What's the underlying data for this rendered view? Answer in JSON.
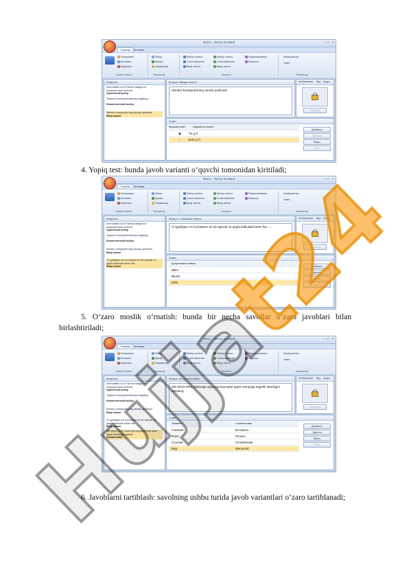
{
  "paragraphs": {
    "p4": "4. Yopiq test: bunda javob varianti o‘quvchi tomonidan kiritiladi;",
    "p5": "5. O‘zaro moslik o‘rnatish: bunda bir necha savollar o‘zaro javoblari bilan birlashtiriladi;",
    "p6": "6. Javoblarni tartiblash: savolning ushbu turida javob variantlari o‘zaro tartiblanadi;"
  },
  "watermark": {
    "part1": "Hujja",
    "part2": "t",
    "part3": "24"
  },
  "screenshots": {
    "s1": {
      "title": "Test 1 - Тесты по Word",
      "tab_active": "Главная",
      "tab_other": "Вставка",
      "pane_left_title": "Вопросы",
      "pane_q_title": "Вопрос \"ввода текста\"",
      "questions": [
        {
          "text": "Informatika va AT fanida falaga sol kompyuterlarni turlicha",
          "type": "Одиночный выбор"
        },
        {
          "text": "Tayanch kompyuterlarning belgilang",
          "type": "Множественный выбор"
        },
        {
          "text": "Monitor-kompyuterning asosiy qurilmasi",
          "type": "Ввод строки"
        }
      ],
      "question_text": "Monitor-kompyuterning asosiy qurilmasi",
      "answers_title": "Ответ",
      "answers_head": [
        "Верный ответ",
        "Варианты ответа"
      ],
      "answers": [
        "To`g`ri",
        "Noto`g`ri"
      ],
      "buttons": [
        "Добавить",
        "Удалить",
        "Вверх",
        "Вниз"
      ],
      "img_tabs": [
        "Изображение",
        "Звук",
        "Видео"
      ],
      "img_btn": "Загрузить"
    },
    "s2": {
      "title": "Test 1 - Тесты по Word",
      "tab_active": "Главная",
      "tab_other": "Вставка",
      "pane_left_title": "Вопросы",
      "pane_q_title": "Вопрос с набором ответа",
      "questions": [
        {
          "text": "Informatika va AT fanida falaga sol kompyuterlarni turlicha",
          "type": "Одиночный выбор"
        },
        {
          "text": "Tayanch kompyuterlarning belgilang",
          "type": "Множественный выбор"
        },
        {
          "text": "Monitor-kompyuterning asosiy qurilmasi",
          "type": "Ввод строки"
        },
        {
          "text": "O`rganilgan mo`lumotlarni so`ab qatnab va qayta kalkuladi belan fan",
          "type": "Ввод строки"
        }
      ],
      "question_text": "O`rganilgan mo`lumotlarni so`ab qatnab va qayta kalkuladi belan fan .....",
      "answers_title": "Ответ",
      "answers_head": [
        "Допустимые ответы"
      ],
      "answers": [
        "Bilim",
        "BILIM",
        "bilim"
      ],
      "buttons": [
        "Добавить",
        "Удалить",
        "Вверх",
        "Вниз"
      ],
      "img_tabs": [
        "Изображение",
        "Звук",
        "Видео"
      ],
      "img_btn": "Загрузить"
    },
    "s3": {
      "title": "Test 1 - Тесты по Word",
      "tab_active": "Главная",
      "tab_other": "Вставка",
      "pane_left_title": "Вопросы",
      "pane_q_title": "Вопрос на соответствие",
      "questions": [
        {
          "text": "Informatika va AT fanida falaga sol kompyuterlarni turlicha",
          "type": "Одиночный выбор"
        },
        {
          "text": "Tayanch kompyuterlarning belgilang",
          "type": "Множественный выбор"
        },
        {
          "text": "Monitor-kompyuterning asosiy qurilmasi",
          "type": "Ввод строки"
        },
        {
          "text": "O`rganilgan mo`lumotlarni so`ab qatnab va qayta kalkuladi belan fan",
          "type": "Ввод строки"
        },
        {
          "text": "MS Word 2010 dasturiga quyidagi buyruqlar qaysi menyuga tegishli",
          "type": "Соответствие"
        }
      ],
      "question_text": "MS Word 2010 dasturiga quyidagi buyruqlar qaysi menyuga tegishli ekanligini aniqlang.",
      "answers_title": "Ответ",
      "answers_head": [
        "Элемент",
        "Соответствие"
      ],
      "left_items": [
        "Главная",
        "Файл",
        "Ссылки",
        "Вид"
      ],
      "right_items": [
        "Вставить",
        "Печать",
        "Оглавление",
        "Масштаб"
      ],
      "buttons": [
        "Добавить",
        "Удалить",
        "Вверх",
        "Вниз"
      ],
      "img_tabs": [
        "Изображение",
        "Звук",
        "Видео"
      ],
      "img_btn": "Загрузить"
    },
    "ribbon_items": [
      "Копировать",
      "Вставить",
      "Вырезать",
      "Абзац",
      "Шрифт",
      "Буфер обмена",
      "Выбор ответа",
      "Сопоставление",
      "Ввод текста",
      "Редактирование",
      "Вопросы",
      "Параметры",
      "Изображение",
      "Ответ"
    ]
  }
}
